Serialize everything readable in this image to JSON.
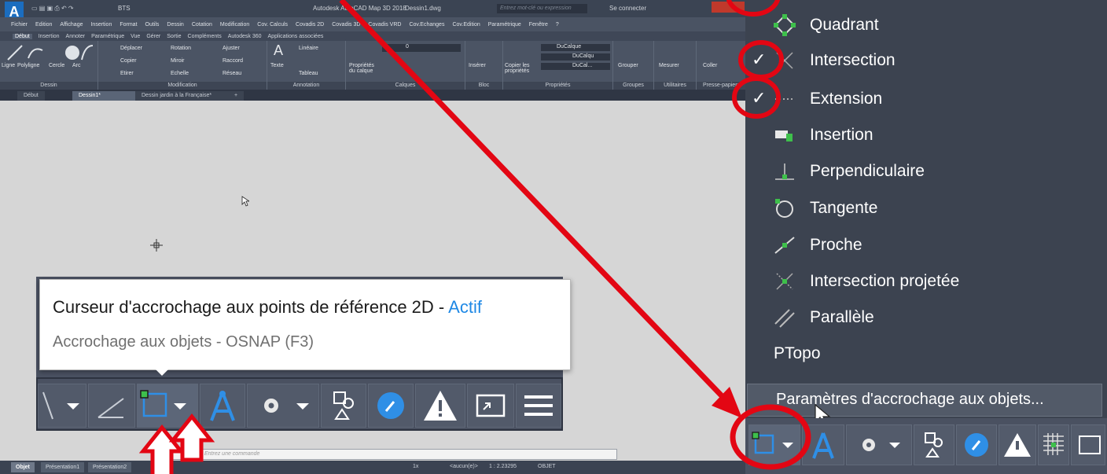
{
  "window": {
    "app_title": "Autodesk AutoCAD Map 3D 2018",
    "doc_name": "Dessin1.dwg",
    "workspace": "BTS",
    "search_placeholder": "Entrez mot-clé ou expression",
    "signin": "Se connecter"
  },
  "menubar": [
    "Fichier",
    "Edition",
    "Affichage",
    "Insertion",
    "Format",
    "Outils",
    "Dessin",
    "Cotation",
    "Modification",
    "Cov. Calculs",
    "Covadis 2D",
    "Covadis 3D",
    "Covadis VRD",
    "Cov.Echanges",
    "Cov.Edition",
    "Paramétrique",
    "Fenêtre",
    "?"
  ],
  "ribbon_tabs": [
    "Début",
    "Insertion",
    "Annoter",
    "Paramétrique",
    "Vue",
    "Gérer",
    "Sortie",
    "Compléments",
    "Autodesk 360",
    "Applications associées"
  ],
  "ribbon": {
    "dessin": {
      "label": "Dessin",
      "tools": [
        "Ligne",
        "Polyligne",
        "Cercle",
        "Arc"
      ]
    },
    "modification": {
      "label": "Modification",
      "tools": [
        "Déplacer",
        "Rotation",
        "Ajuster",
        "Copier",
        "Miroir",
        "Raccord",
        "Etirer",
        "Echelle",
        "Réseau"
      ]
    },
    "annotation": {
      "label": "Annotation",
      "tools": [
        "Texte",
        "Linéaire",
        "Tableau"
      ]
    },
    "calques": {
      "label": "Calques",
      "tools": [
        "Propriétés du calque"
      ],
      "layer_value": "0"
    },
    "bloc": {
      "label": "Bloc",
      "tools": [
        "Insérer"
      ]
    },
    "proprietes": {
      "label": "Propriétés",
      "tools": [
        "Copier les propriétés"
      ],
      "values": [
        "DuCalque",
        "DuCalqu",
        "DuCal..."
      ]
    },
    "groupes": {
      "label": "Groupes",
      "tools": [
        "Grouper"
      ]
    },
    "utilitaires": {
      "label": "Utilitaires",
      "tools": [
        "Mesurer"
      ]
    },
    "presse": {
      "label": "Presse-papiers",
      "tools": [
        "Coller"
      ]
    }
  },
  "doc_tabs": [
    "Début",
    "Dessin1*",
    "Dessin jardin à la Française*"
  ],
  "layout_tabs": [
    "Objet",
    "Présentation1",
    "Présentation2"
  ],
  "command_placeholder": "Entrez une commande",
  "statusbar": {
    "scale": "1x",
    "annotation": "<aucun(e)>",
    "zoom": "1 : 2.23295",
    "mode": "OBJET"
  },
  "tooltip": {
    "title_main": "Curseur d'accrochage aux points de référence 2D - ",
    "title_status": "Actif",
    "subtitle": "Accrochage aux objets - OSNAP (F3)"
  },
  "osnap_menu": {
    "items": [
      {
        "label": "Quadrant",
        "checked": false,
        "icon": "quadrant-icon"
      },
      {
        "label": "Intersection",
        "checked": true,
        "icon": "intersection-icon"
      },
      {
        "label": "Extension",
        "checked": true,
        "icon": "extension-icon"
      },
      {
        "label": "Insertion",
        "checked": false,
        "icon": "insertion-icon"
      },
      {
        "label": "Perpendiculaire",
        "checked": false,
        "icon": "perpendicular-icon"
      },
      {
        "label": "Tangente",
        "checked": false,
        "icon": "tangent-icon"
      },
      {
        "label": "Proche",
        "checked": false,
        "icon": "nearest-icon"
      },
      {
        "label": "Intersection projetée",
        "checked": false,
        "icon": "projected-intersection-icon"
      },
      {
        "label": "Parallèle",
        "checked": false,
        "icon": "parallel-icon"
      },
      {
        "label": "PTopo",
        "checked": false,
        "icon": ""
      }
    ],
    "settings_label": "Paramètres d'accrochage aux objets...",
    "check_glyph": "✓"
  },
  "colors": {
    "annotation_red": "#e30613",
    "active_blue": "#1e88e5",
    "dark_ui": "#3c4350"
  }
}
